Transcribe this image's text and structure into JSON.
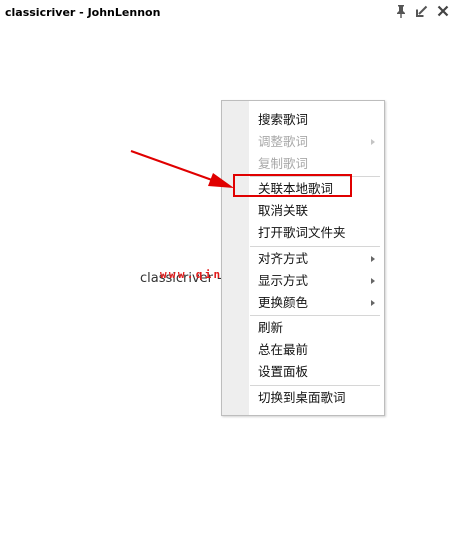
{
  "window": {
    "title": "classicriver - JohnLennon",
    "buttons": [
      {
        "name": "pin-icon"
      },
      {
        "name": "minimize-icon"
      },
      {
        "name": "close-icon"
      }
    ]
  },
  "lyrics": {
    "current_line": "classicriver -"
  },
  "watermark": {
    "text": "www.qinpinchang.com"
  },
  "context_menu": {
    "items": [
      {
        "label": "搜索歌词"
      },
      {
        "label": "调整歌词"
      },
      {
        "label": "复制歌词"
      },
      {
        "label": "关联本地歌词"
      },
      {
        "label": "取消关联"
      },
      {
        "label": "打开歌词文件夹"
      },
      {
        "label": "对齐方式"
      },
      {
        "label": "显示方式"
      },
      {
        "label": "更换颜色"
      },
      {
        "label": "刷新"
      },
      {
        "label": "总在最前"
      },
      {
        "label": "设置面板"
      },
      {
        "label": "切换到桌面歌词"
      }
    ]
  },
  "annotation": {
    "color": "#e00000"
  }
}
